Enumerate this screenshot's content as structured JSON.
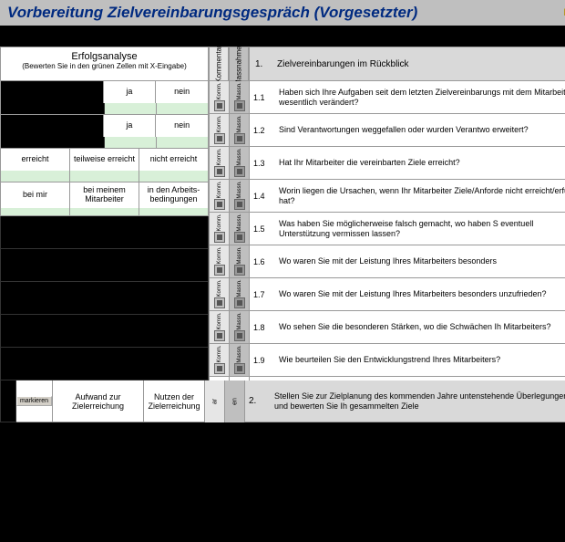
{
  "title": "Vorbereitung Zielvereinbarungsgespräch (Vorgesetzter)",
  "title_right": "Fo",
  "analysis": {
    "header": "Erfolgsanalyse",
    "subheader": "(Bewerten Sie in den grünen Zellen mit X-Eingabe)",
    "r1": {
      "a": "ja",
      "b": "nein"
    },
    "r2": {
      "a": "ja",
      "b": "nein"
    },
    "r3": {
      "a": "erreicht",
      "b": "teilweise erreicht",
      "c": "nicht erreicht"
    },
    "r4": {
      "a": "bei mir",
      "b": "bei meinem Mitarbeiter",
      "c": "in den Arbeits-bedingungen"
    }
  },
  "narrow": {
    "komm_full": "Kommentar",
    "mass_full": "Massnahmen",
    "komm": "Komm.",
    "mass": "Massn."
  },
  "section_header": {
    "num": "1.",
    "txt": "Zielvereinbarungen im Rückblick"
  },
  "questions": [
    {
      "num": "1.1",
      "txt": "Haben sich Ihre Aufgaben seit dem letzten Zielvereinbarungs mit dem Mitarbeiter wesentlich verändert?"
    },
    {
      "num": "1.2",
      "txt": "Sind Verantwortungen weggefallen oder wurden Verantwo erweitert?"
    },
    {
      "num": "1.3",
      "txt": "Hat Ihr Mitarbeiter die vereinbarten Ziele erreicht?"
    },
    {
      "num": "1.4",
      "txt": "Worin liegen die Ursachen, wenn Ihr Mitarbeiter Ziele/Anforde nicht erreicht/erfüllt hat?"
    },
    {
      "num": "1.5",
      "txt": "Was haben Sie möglicherweise falsch gemacht, wo haben S eventuell Unterstützung vermissen lassen?"
    },
    {
      "num": "1.6",
      "txt": "Wo waren Sie mit der Leistung Ihres Mitarbeiters besonders"
    },
    {
      "num": "1.7",
      "txt": "Wo waren Sie mit der Leistung Ihres Mitarbeiters besonders unzufrieden?"
    },
    {
      "num": "1.8",
      "txt": "Wo sehen Sie die besonderen Stärken, wo die Schwächen Ih Mitarbeiters?"
    },
    {
      "num": "1.9",
      "txt": "Wie beurteilen Sie den Entwicklungstrend Ihres Mitarbeiters?"
    }
  ],
  "footer": {
    "btn": "markieren",
    "a": "Aufwand zur Zielerreichung",
    "b": "Nutzen der Zielerreichung",
    "num": "2.",
    "txt": "Stellen Sie zur Zielplanung des kommenden Jahre untenstehende Überlegungen an und bewerten Sie Ih gesammelten Ziele"
  }
}
